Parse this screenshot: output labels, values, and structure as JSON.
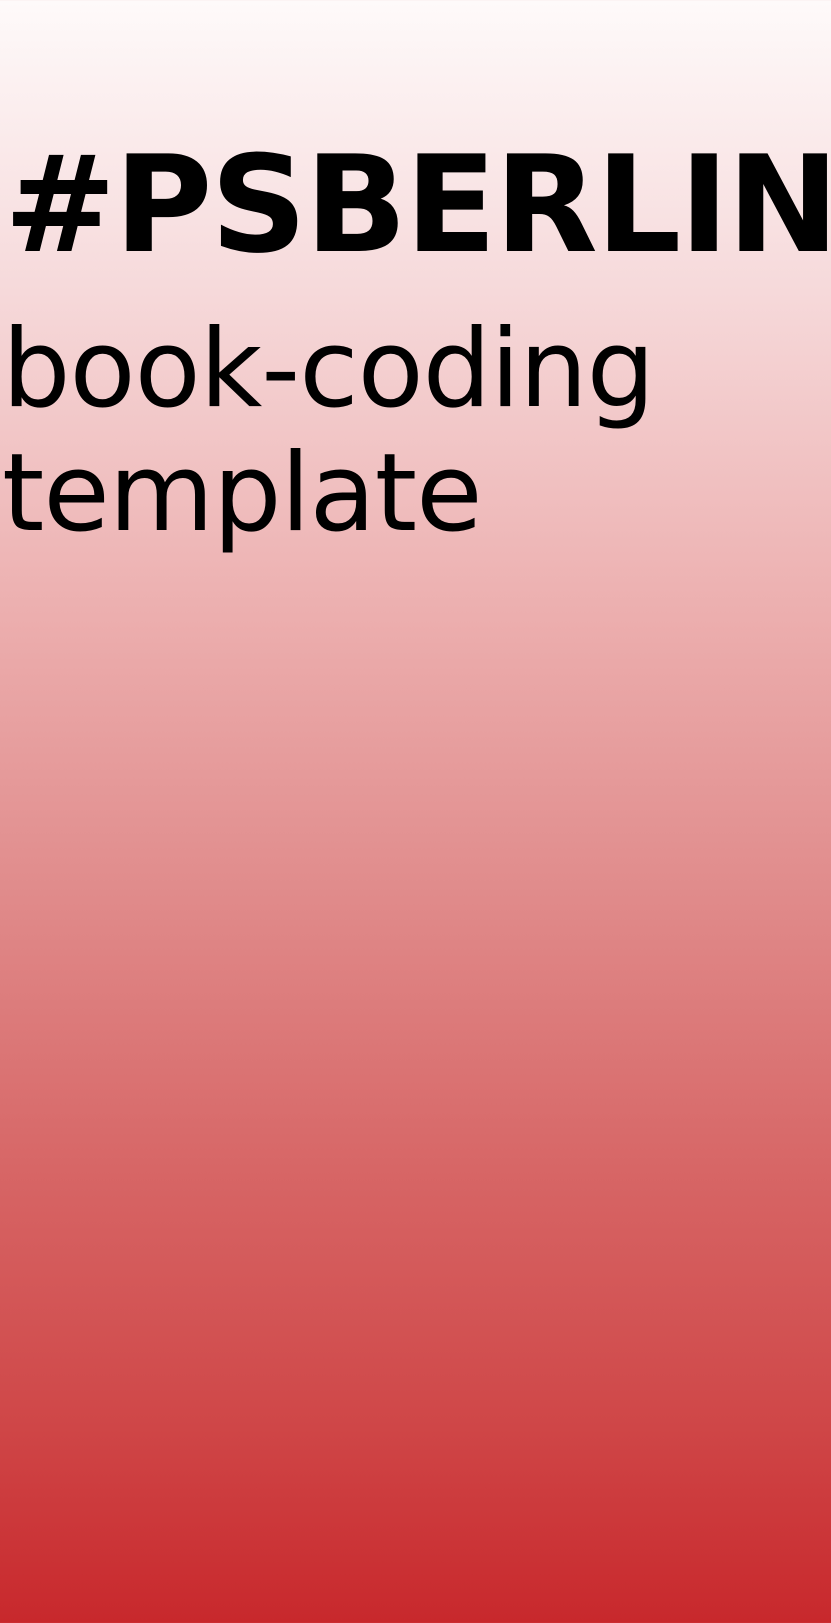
{
  "headline": "#PSBERLIN",
  "subtitle": {
    "line1": "book-coding",
    "line2": "template"
  },
  "colors": {
    "gradient_top": "#fefafa",
    "gradient_bottom": "#c8282c",
    "text": "#000000"
  }
}
